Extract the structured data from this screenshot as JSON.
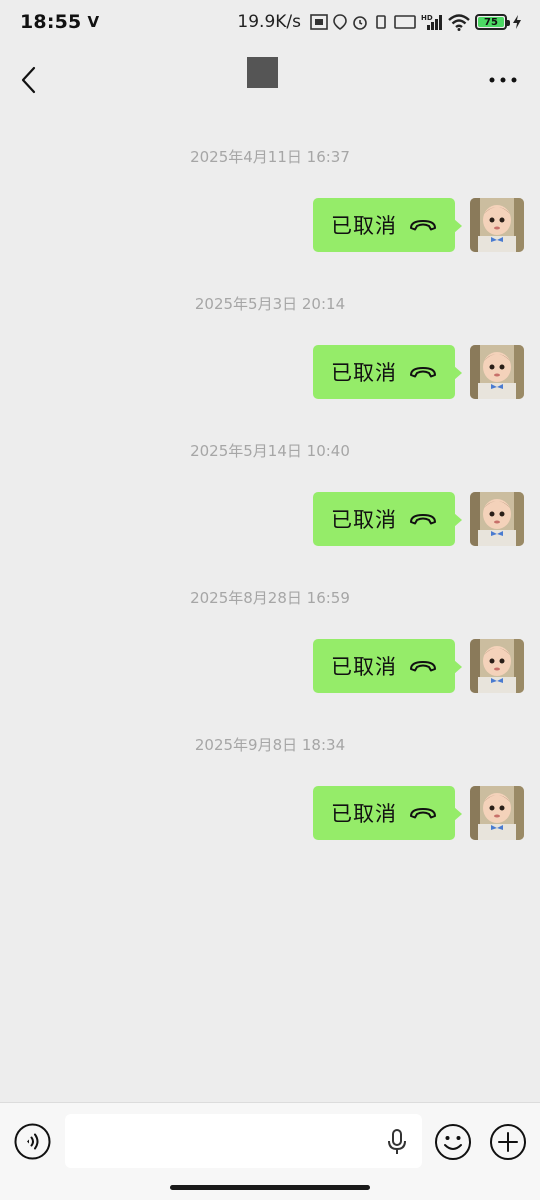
{
  "status_bar": {
    "time": "18:55",
    "mark": "V",
    "net_speed": "19.9K/s",
    "battery": "75"
  },
  "nav": {
    "back_icon": "chevron-left-icon",
    "more_icon": "more-dots-icon"
  },
  "messages": [
    {
      "timestamp": "2025年4月11日 16:37",
      "text": "已取消"
    },
    {
      "timestamp": "2025年5月3日 20:14",
      "text": "已取消"
    },
    {
      "timestamp": "2025年5月14日 10:40",
      "text": "已取消"
    },
    {
      "timestamp": "2025年8月28日 16:59",
      "text": "已取消"
    },
    {
      "timestamp": "2025年9月8日 18:34",
      "text": "已取消"
    }
  ],
  "input_bar": {
    "value": "",
    "icons": [
      "voice-icon",
      "mic-icon",
      "emoji-icon",
      "plus-icon"
    ]
  },
  "colors": {
    "background": "#ededed",
    "bubble": "#95ec69",
    "timestamp": "#a6a6a6",
    "battery": "#4cd964"
  }
}
